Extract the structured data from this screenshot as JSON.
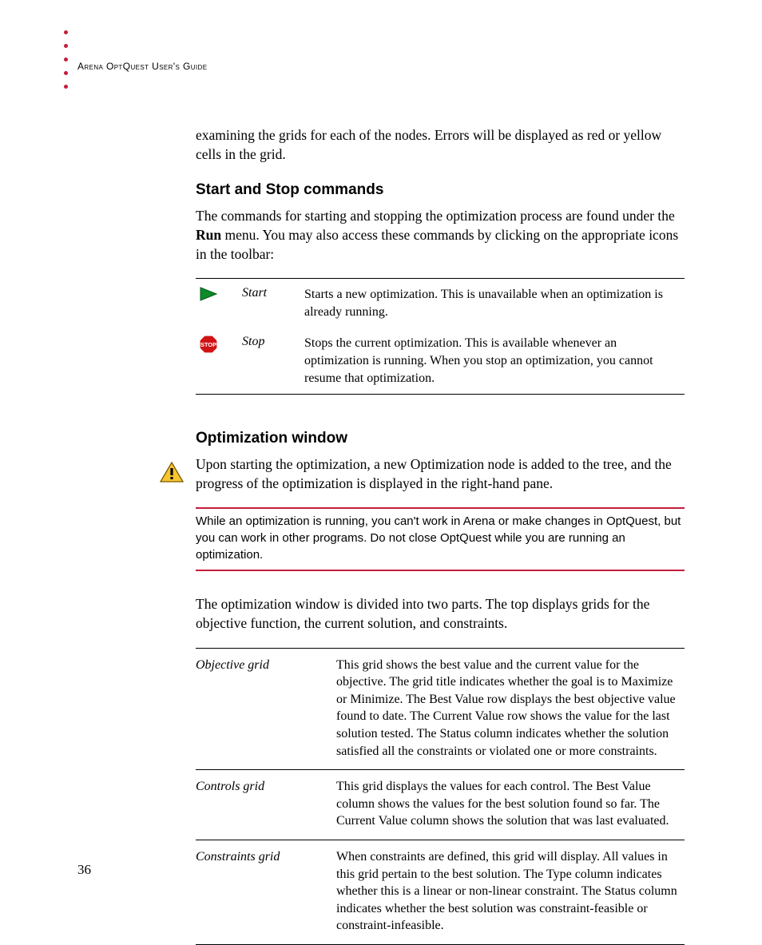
{
  "header": {
    "running_head": "Arena OptQuest User's Guide"
  },
  "intro_para": "examining the grids for each of the nodes. Errors will be displayed as red or yellow cells in the grid.",
  "section1": {
    "title": "Start and Stop commands",
    "para_a": "The commands for starting and stopping the optimization process are found under the ",
    "para_bold": "Run",
    "para_b": " menu. You may also access these commands by clicking on the appropriate icons in the toolbar:"
  },
  "commands": [
    {
      "name": "Start",
      "desc": "Starts a new optimization. This is unavailable when an optimization is already running."
    },
    {
      "name": "Stop",
      "desc": "Stops the current optimization. This is available whenever an optimization is running. When you stop an optimization, you cannot resume that optimization."
    }
  ],
  "section2": {
    "title": "Optimization window",
    "para1": "Upon starting the optimization, a new Optimization node is added to the tree, and the progress of the optimization is displayed in the right-hand pane.",
    "note": "While an optimization is running, you can't work in Arena or make changes in OptQuest, but you can work in other programs. Do not close OptQuest while you are running an optimization.",
    "para2": "The optimization window is divided into two parts. The top displays grids for the objective function, the current solution, and constraints."
  },
  "grids": [
    {
      "name": "Objective grid",
      "desc": "This grid shows the best value and the current value for the objective. The grid title indicates whether the goal is to Maximize or Minimize. The Best Value row displays the best objective value found to date. The Current Value row shows the value for the last solution tested. The Status column indicates whether the solution satisfied all the constraints or violated one or more constraints."
    },
    {
      "name": "Controls grid",
      "desc": "This grid displays the values for each control. The Best Value column shows the values for the best solution found so far. The Current Value column shows the solution that was last evaluated."
    },
    {
      "name": "Constraints grid",
      "desc": "When constraints are defined, this grid will display. All values in this grid pertain to the best solution. The Type column indicates whether this is a linear or non-linear constraint. The Status column indicates whether the best solution was constraint-feasible or constraint-infeasible."
    }
  ],
  "page_number": "36"
}
